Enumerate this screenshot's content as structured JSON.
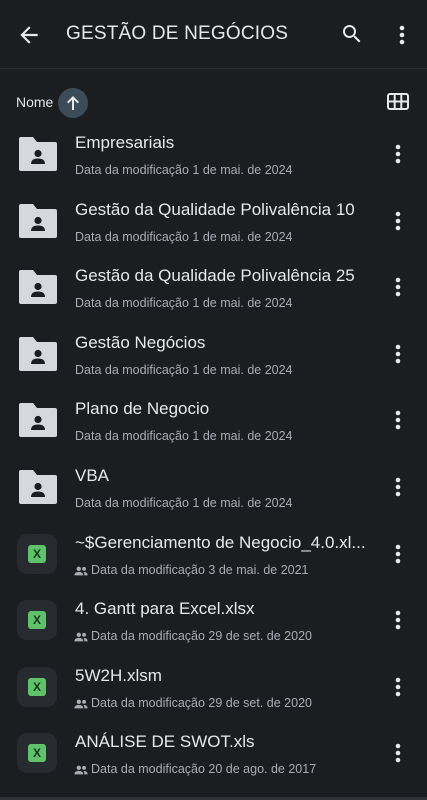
{
  "appbar": {
    "title": "GESTÃO DE NEGÓCIOS",
    "back_icon": "arrow-left-icon",
    "search_icon": "search-icon",
    "more_icon": "more-vert-icon"
  },
  "sortbar": {
    "label": "Nome",
    "sort_icon": "arrow-up-icon",
    "view_icon": "grid-view-icon"
  },
  "colors": {
    "background": "#1b1d20",
    "sort_chip": "#3b4c58",
    "excel_green": "#5fc26a"
  },
  "items": [
    {
      "name": "Empresariais",
      "meta": "Data da modificação 1 de mai. de 2024",
      "type": "shared-folder"
    },
    {
      "name": "Gestão da Qualidade Polivalência 10",
      "meta": "Data da modificação 1 de mai. de 2024",
      "type": "shared-folder"
    },
    {
      "name": "Gestão da Qualidade Polivalência 25",
      "meta": "Data da modificação 1 de mai. de 2024",
      "type": "shared-folder"
    },
    {
      "name": "Gestão Negócios",
      "meta": "Data da modificação 1 de mai. de 2024",
      "type": "shared-folder"
    },
    {
      "name": "Plano de Negocio",
      "meta": "Data da modificação 1 de mai. de 2024",
      "type": "shared-folder"
    },
    {
      "name": "VBA",
      "meta": "Data da modificação 1 de mai. de 2024",
      "type": "shared-folder"
    },
    {
      "name": "~$Gerenciamento de Negocio_4.0.xl...",
      "meta": "Data da modificação 3 de mai. de 2021",
      "type": "excel",
      "badge": "X"
    },
    {
      "name": "4. Gantt para Excel.xlsx",
      "meta": "Data da modificação 29 de set. de 2020",
      "type": "excel",
      "badge": "X"
    },
    {
      "name": "5W2H.xlsm",
      "meta": "Data da modificação 29 de set. de 2020",
      "type": "excel",
      "badge": "X"
    },
    {
      "name": "ANÁLISE DE SWOT.xls",
      "meta": "Data da modificação 20 de ago. de 2017",
      "type": "excel",
      "badge": "X"
    }
  ]
}
